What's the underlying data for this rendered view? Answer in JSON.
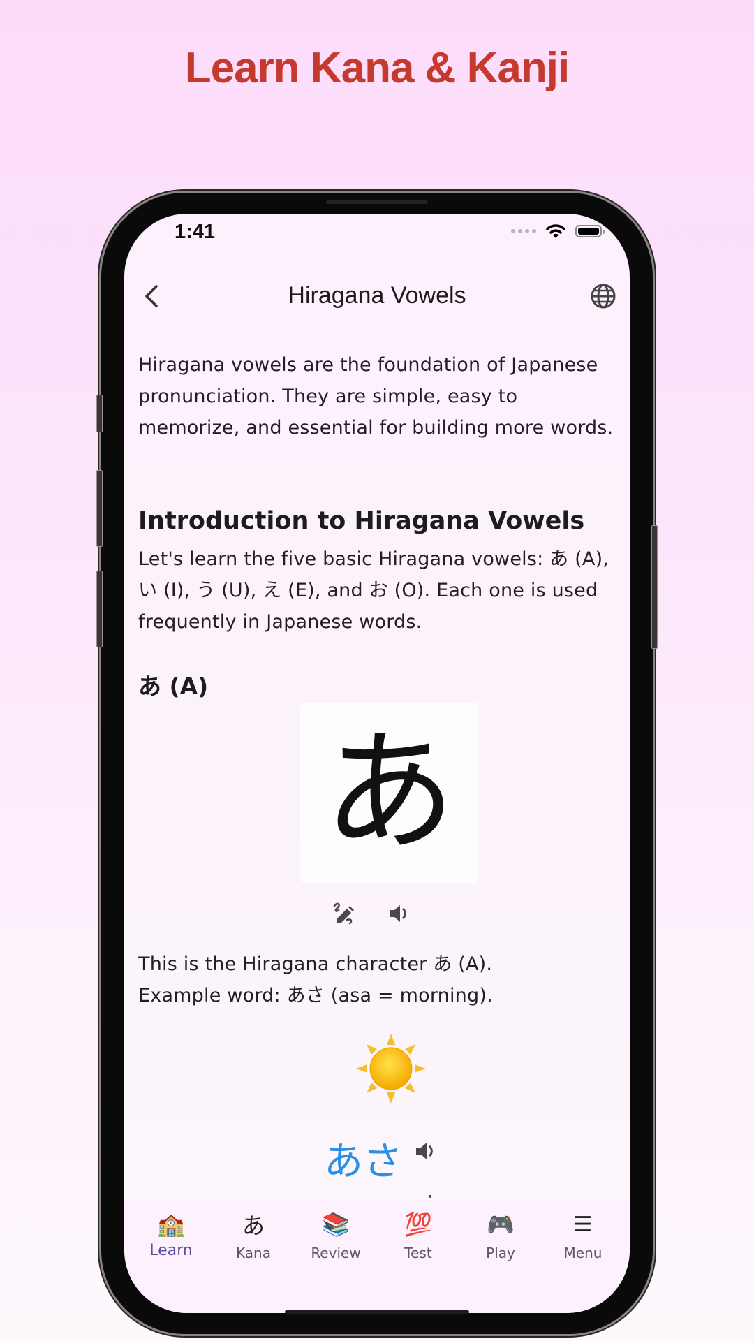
{
  "promo": {
    "title": "Learn Kana & Kanji"
  },
  "status_bar": {
    "time": "1:41"
  },
  "nav": {
    "title": "Hiragana Vowels",
    "back_icon": "chevron-left-icon",
    "language_icon": "globe-icon"
  },
  "content": {
    "intro": "Hiragana vowels are the foundation of Japanese pronunciation. They are simple, easy to memorize, and essential for building more words.",
    "section_heading": "Introduction to Hiragana Vowels",
    "section_body": "Let's learn the five basic Hiragana vowels: あ (A), い (I), う (U), え (E), and お (O). Each one is used frequently in Japanese words.",
    "character_heading": "あ (A)",
    "character": "あ",
    "stroke_icon": "draw-pencil-icon",
    "audio_icon": "speaker-icon",
    "character_description_line1": "This is the Hiragana character あ (A).",
    "character_description_line2": "Example word: あさ (asa = morning).",
    "example_emoji": "sun-emoji",
    "example_word": "あさ",
    "example_romaji": "asa = morning"
  },
  "tabbar": {
    "active": "Learn",
    "tabs": [
      {
        "label": "Learn",
        "icon": "🏫"
      },
      {
        "label": "Kana",
        "icon": "あ"
      },
      {
        "label": "Review",
        "icon": "📚"
      },
      {
        "label": "Test",
        "icon": "💯"
      },
      {
        "label": "Play",
        "icon": "🎮"
      },
      {
        "label": "Menu",
        "icon": "☰"
      }
    ]
  },
  "colors": {
    "promo_title": "#c43a2e",
    "example_word": "#2b8fe4",
    "active_tab": "#5a4f9c"
  }
}
